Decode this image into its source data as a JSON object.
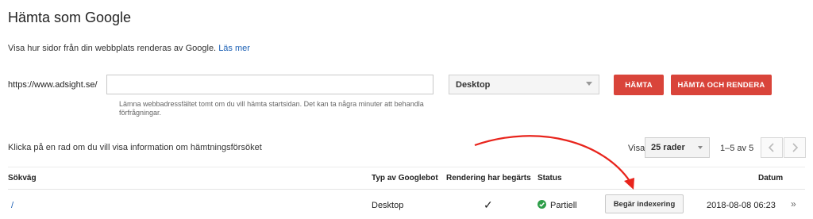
{
  "header": {
    "title": "Hämta som Google",
    "subtitle": "Visa hur sidor från din webbplats renderas av Google.",
    "learn_more": "Läs mer"
  },
  "fetch_form": {
    "url_prefix": "https://www.adsight.se/",
    "url_value": "",
    "hint": "Lämna webbadressfältet tomt om du vill hämta startsidan. Det kan ta några minuter att behandla förfrågningar.",
    "device_selected": "Desktop",
    "fetch_button": "HÄMTA",
    "fetch_render_button": "HÄMTA OCH RENDERA"
  },
  "table_controls": {
    "click_hint": "Klicka på en rad om du vill visa information om hämtningsförsöket",
    "show_label": "Visa",
    "rows_selected": "25 rader",
    "range": "1–5 av 5"
  },
  "table": {
    "headers": {
      "path": "Sökväg",
      "googlebot_type": "Typ av Googlebot",
      "rendering_requested": "Rendering har begärts",
      "status": "Status",
      "date": "Datum"
    },
    "rows": [
      {
        "path": "/",
        "googlebot_type": "Desktop",
        "rendering_requested": "✓",
        "status": "Partiell",
        "action": "Begär indexering",
        "date": "2018-08-08 06:23",
        "more": "»"
      }
    ]
  },
  "colors": {
    "accent_red": "#d9443a",
    "link_blue": "#1a5fb4",
    "status_green": "#2e9e49",
    "annotation_red": "#e8241c"
  }
}
